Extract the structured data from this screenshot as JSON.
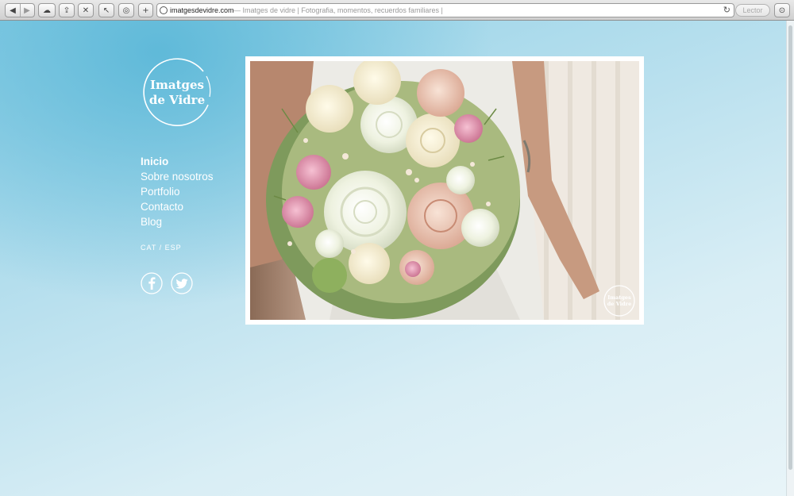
{
  "browser": {
    "url_domain": "imatgesdevidre.com",
    "page_title": "— Imatges de vidre | Fotografia, momentos, recuerdos familiares |",
    "reader_label": "Lector"
  },
  "site": {
    "logo_text_line1": "Imatges",
    "logo_text_line2": "de Vidre",
    "nav": [
      {
        "label": "Inicio",
        "active": true
      },
      {
        "label": "Sobre nosotros"
      },
      {
        "label": "Portfolio"
      },
      {
        "label": "Contacto"
      },
      {
        "label": "Blog"
      }
    ],
    "language_switch": "CAT / ESP",
    "social": [
      "facebook-icon",
      "twitter-icon"
    ],
    "watermark_line1": "Imatges",
    "watermark_line2": "de Vidre"
  },
  "colors": {
    "accent": "#5bb8d8",
    "text": "#ffffff"
  }
}
